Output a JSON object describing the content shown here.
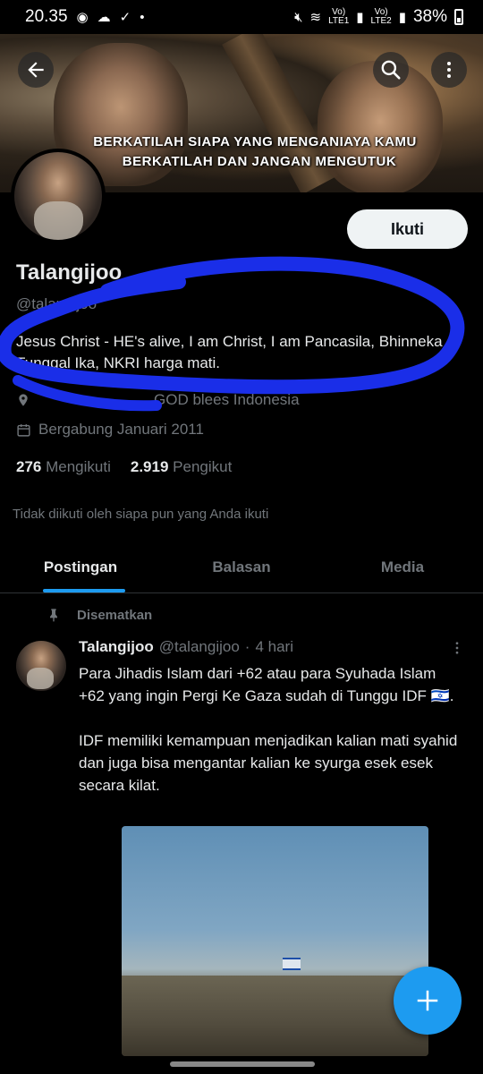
{
  "status_bar": {
    "time": "20.35",
    "net1": "Vo)\nLTE1",
    "net2": "Vo)\nLTE2",
    "battery": "38%"
  },
  "banner": {
    "line1": "BERKATILAH SIAPA YANG MENGANIAYA KAMU",
    "line2": "BERKATILAH DAN JANGAN MENGUTUK"
  },
  "icons": {
    "back": "arrow-left-icon",
    "search": "search-icon",
    "more": "more-vertical-icon",
    "calendar": "calendar-icon",
    "location": "location-pin-icon",
    "pin": "pin-icon",
    "compose": "plus-icon"
  },
  "profile": {
    "follow_label": "Ikuti",
    "display_name": "Talangijoo",
    "handle": "@talangijoo",
    "bio": "Jesus Christ - HE's alive, I am Christ, I am  Pancasila, Bhinneka Tunggal Ika, NKRI harga mati.",
    "location": "GOD blees Indonesia",
    "joined": "Bergabung Januari 2011",
    "following_count": "276",
    "following_label": "Mengikuti",
    "followers_count": "2.919",
    "followers_label": "Pengikut",
    "not_followed_note": "Tidak diikuti oleh siapa pun yang Anda ikuti"
  },
  "tabs": [
    {
      "label": "Postingan",
      "active": true
    },
    {
      "label": "Balasan",
      "active": false
    },
    {
      "label": "Media",
      "active": false
    }
  ],
  "pinned_post": {
    "pinned_label": "Disematkan",
    "author_name": "Talangijoo",
    "author_handle": "@talangijoo",
    "separator": "·",
    "time": "4 hari",
    "text": "Para Jihadis Islam dari +62 atau para Syuhada Islam +62 yang ingin Pergi Ke Gaza sudah di Tunggu IDF 🇮🇱.\n\nIDF memiliki kemampuan menjadikan kalian mati syahid dan juga bisa mengantar kalian ke syurga esek esek secara kilat."
  },
  "colors": {
    "accent": "#1d9bf0",
    "annotation": "#1a2ee8",
    "muted_text": "#71767b",
    "background": "#000000"
  }
}
